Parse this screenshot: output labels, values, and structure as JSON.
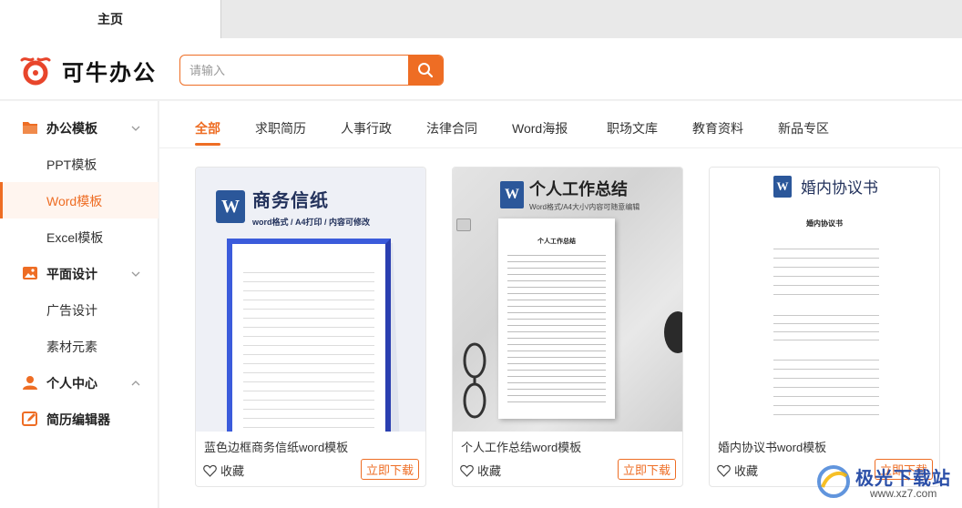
{
  "tabbar": {
    "active_tab": "主页"
  },
  "header": {
    "app_name": "可牛办公",
    "search_placeholder": "请输入",
    "brand_color": "#ee6d24"
  },
  "sidebar": {
    "categories": [
      {
        "label": "办公模板",
        "icon": "folder-icon",
        "expanded": true,
        "items": [
          "PPT模板",
          "Word模板",
          "Excel模板"
        ]
      },
      {
        "label": "平面设计",
        "icon": "image-icon",
        "expanded": true,
        "items": [
          "广告设计",
          "素材元素"
        ]
      },
      {
        "label": "个人中心",
        "icon": "user-icon",
        "expanded": false,
        "items": []
      },
      {
        "label": "简历编辑器",
        "icon": "edit-icon",
        "expanded": false,
        "items": []
      }
    ],
    "active_item": "Word模板"
  },
  "category_tabs": [
    "全部",
    "求职简历",
    "人事行政",
    "法律合同",
    "Word海报",
    "职场文库",
    "教育资料",
    "新品专区"
  ],
  "active_category": "全部",
  "cards": [
    {
      "title": "蓝色边框商务信纸word模板",
      "thumb_heading": "商务信纸",
      "thumb_sub": "word格式 / A4打印 / 内容可修改",
      "favorite_label": "收藏",
      "download_label": "立即下载"
    },
    {
      "title": "个人工作总结word模板",
      "thumb_heading": "个人工作总结",
      "thumb_sub": "Word格式/A4大小/内容可随意编辑",
      "doc_title": "个人工作总结",
      "favorite_label": "收藏",
      "download_label": "立即下载"
    },
    {
      "title": "婚内协议书word模板",
      "thumb_heading": "婚内协议书",
      "doc_title": "婚内协议书",
      "favorite_label": "收藏",
      "download_label": "立即下载"
    }
  ],
  "watermark": {
    "text": "极光下载站",
    "url_text": "www.xz7.com"
  }
}
